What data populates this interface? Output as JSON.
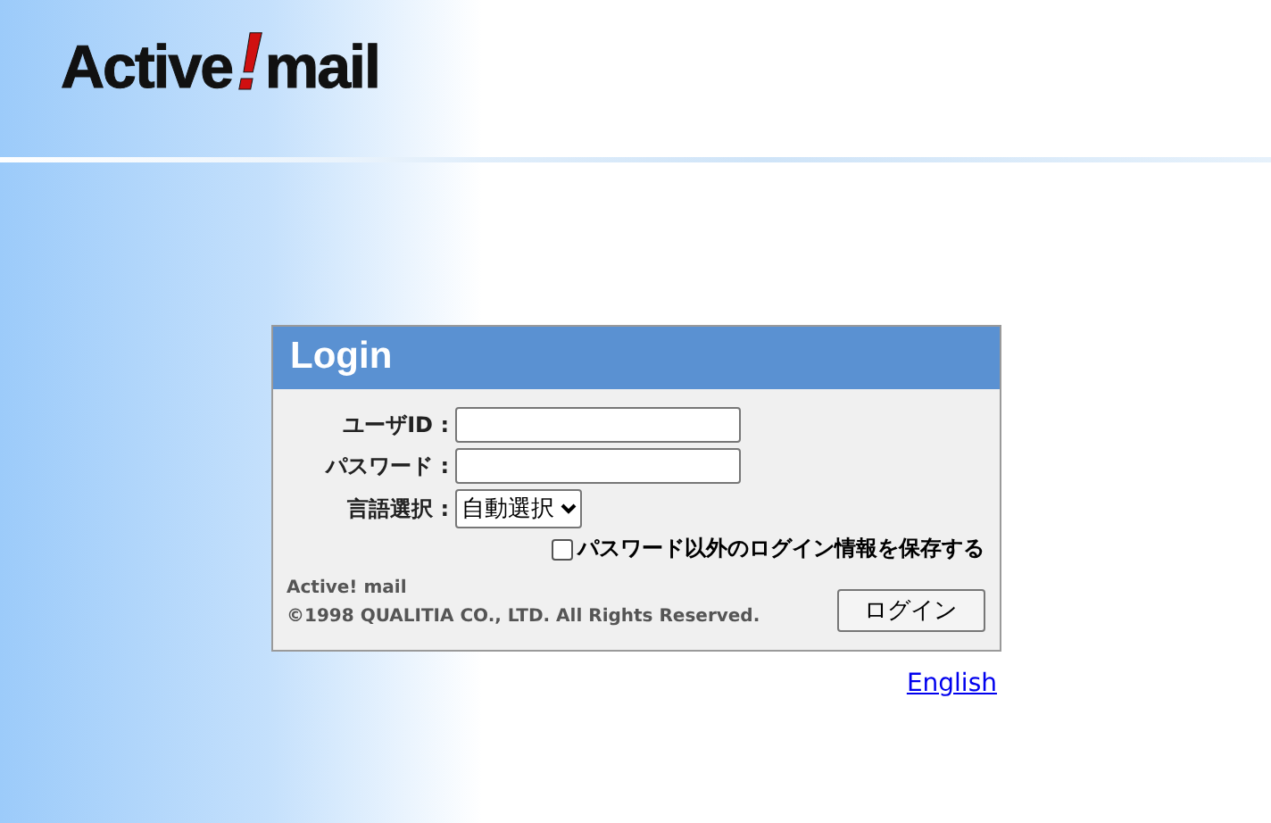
{
  "logo": {
    "word_1": "Active",
    "mark": "!",
    "word_2": "mail"
  },
  "login": {
    "title": "Login",
    "fields": [
      {
        "kind": "text",
        "label": "ユーザID :"
      },
      {
        "kind": "password",
        "label": "パスワード :"
      },
      {
        "kind": "select",
        "label": "言語選択 :",
        "value": "自動選択"
      }
    ],
    "remember": {
      "label": "パスワード以外のログイン情報を保存する",
      "checked": false
    },
    "product": "Active! mail",
    "copyright": "©1998 QUALITIA CO., LTD. All Rights Reserved.",
    "button": "ログイン"
  },
  "language_link": "English"
}
